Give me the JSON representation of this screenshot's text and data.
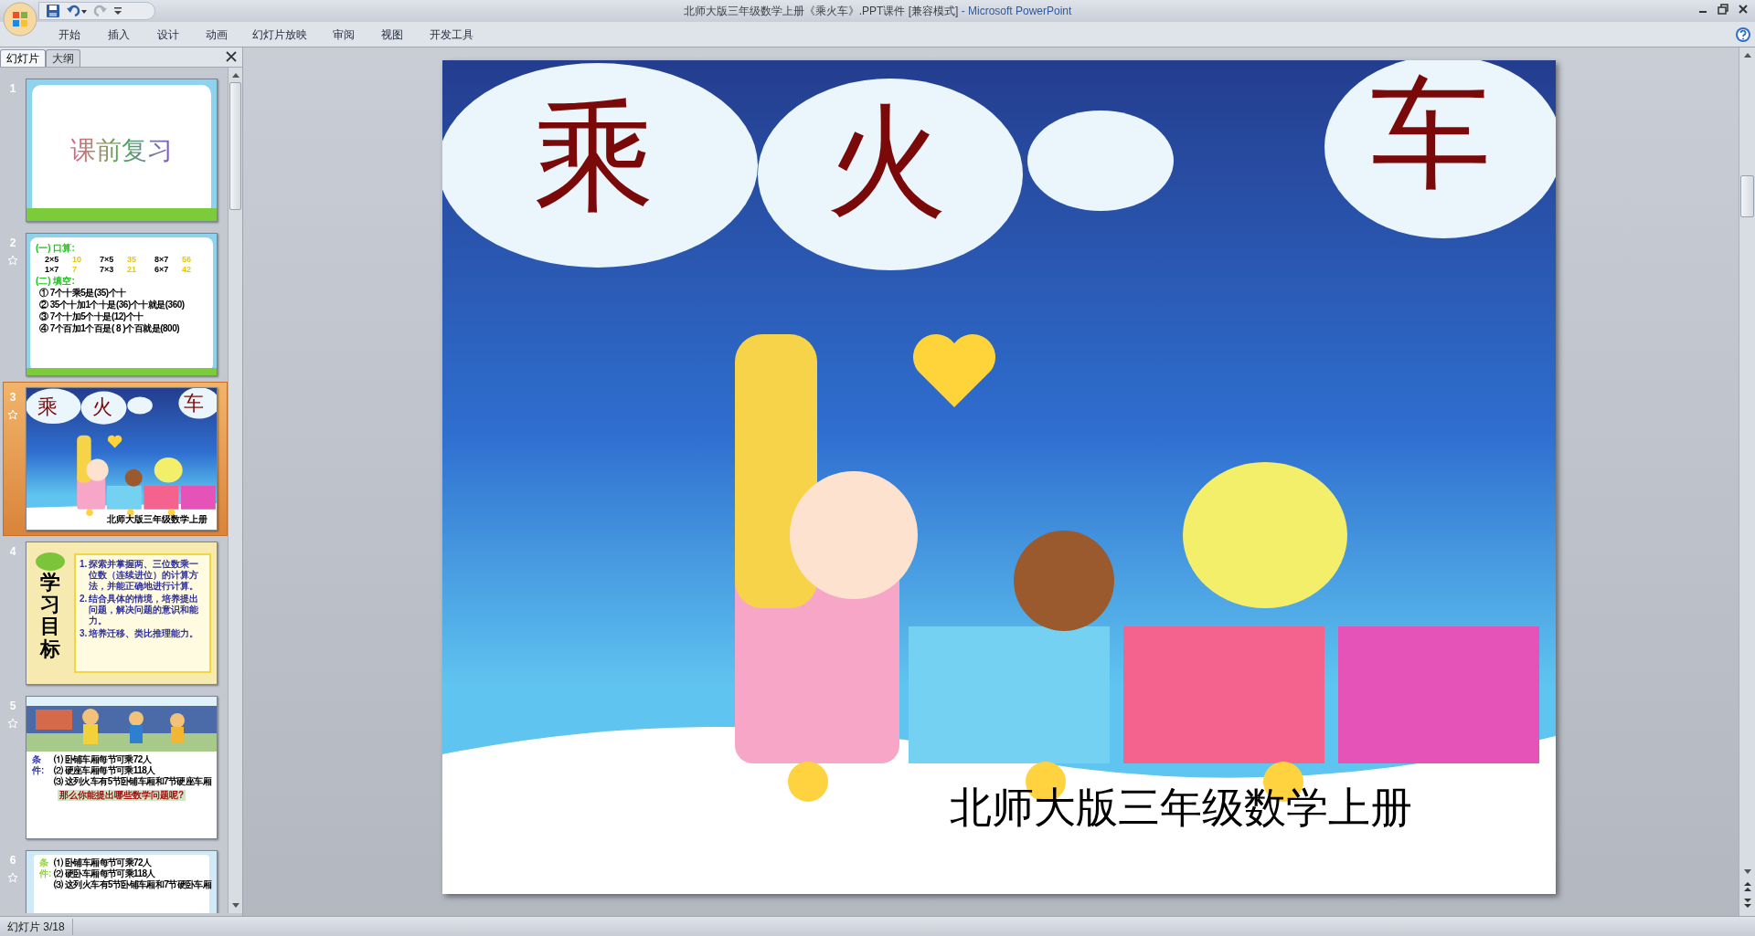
{
  "window": {
    "title_document": "北师大版三年级数学上册《乘火车》.PPT课件 [兼容模式]",
    "title_app": " - Microsoft PowerPoint"
  },
  "ribbon_tabs": [
    {
      "label": "开始",
      "selected": false
    },
    {
      "label": "插入",
      "selected": false
    },
    {
      "label": "设计",
      "selected": false
    },
    {
      "label": "动画",
      "selected": false
    },
    {
      "label": "幻灯片放映",
      "selected": false
    },
    {
      "label": "审阅",
      "selected": false
    },
    {
      "label": "视图",
      "selected": false
    },
    {
      "label": "开发工具",
      "selected": false
    }
  ],
  "panel_tabs": [
    {
      "label": "幻灯片",
      "selected": true
    },
    {
      "label": "大纲",
      "selected": false
    }
  ],
  "thumbnails": [
    {
      "number": "1",
      "animated": false,
      "selected": false,
      "kind": "title",
      "title": "课前复习"
    },
    {
      "number": "2",
      "animated": true,
      "selected": false,
      "kind": "exercise",
      "heading_1": "(一) 口算:",
      "sums": [
        [
          "2×5",
          "10"
        ],
        [
          "7×5",
          "35"
        ],
        [
          "8×7",
          "56"
        ],
        [
          "1×7",
          "7"
        ],
        [
          "7×3",
          "21"
        ],
        [
          "6×7",
          "42"
        ]
      ],
      "heading_2": "(二) 填空:",
      "lines": [
        "① 7个十乘5是(35)个十",
        "② 35个十加1个十是(36)个十就是(360)",
        "③ 7个十加5个十是(12)个十",
        "④ 7个百加1个百是( 8 )个百就是(800)"
      ]
    },
    {
      "number": "3",
      "animated": true,
      "selected": true,
      "kind": "cover",
      "chars": [
        "乘",
        "火",
        "车"
      ],
      "subtitle": "北师大版三年级数学上册"
    },
    {
      "number": "4",
      "animated": false,
      "selected": false,
      "kind": "goals",
      "heading": "学习目标",
      "items": [
        {
          "number": "1.",
          "text": "探索并掌握两、三位数乘一位数（连续进位）的计算方法，并能正确地进行计算。"
        },
        {
          "number": "2.",
          "text": "结合具体的情境，培养提出问题，解决问题的意识和能力。"
        },
        {
          "number": "3.",
          "text": "培养迁移、类比推理能力。"
        }
      ]
    },
    {
      "number": "5",
      "animated": true,
      "selected": false,
      "kind": "conditions",
      "label": "条件:",
      "lines": [
        "⑴ 卧铺车厢每节可乘72人",
        "⑵ 硬座车厢每节可乘118人",
        "⑶ 这列火车有5节卧铺车厢和7节硬座车厢"
      ],
      "question": "那么你能提出哪些数学问题呢?"
    },
    {
      "number": "6",
      "animated": true,
      "selected": false,
      "kind": "conditions",
      "label": "条件:",
      "lines": [
        "⑴ 卧铺车厢每节可乘72人",
        "⑵ 硬卧车厢每节可乘118人",
        "⑶ 这列火车有5节卧铺车厢和7节硬卧车厢"
      ]
    }
  ],
  "slide": {
    "chars": [
      "乘",
      "火",
      "车"
    ],
    "subtitle": "北师大版三年级数学上册"
  },
  "status_bar": {
    "slide_counter": "幻灯片 3/18"
  }
}
